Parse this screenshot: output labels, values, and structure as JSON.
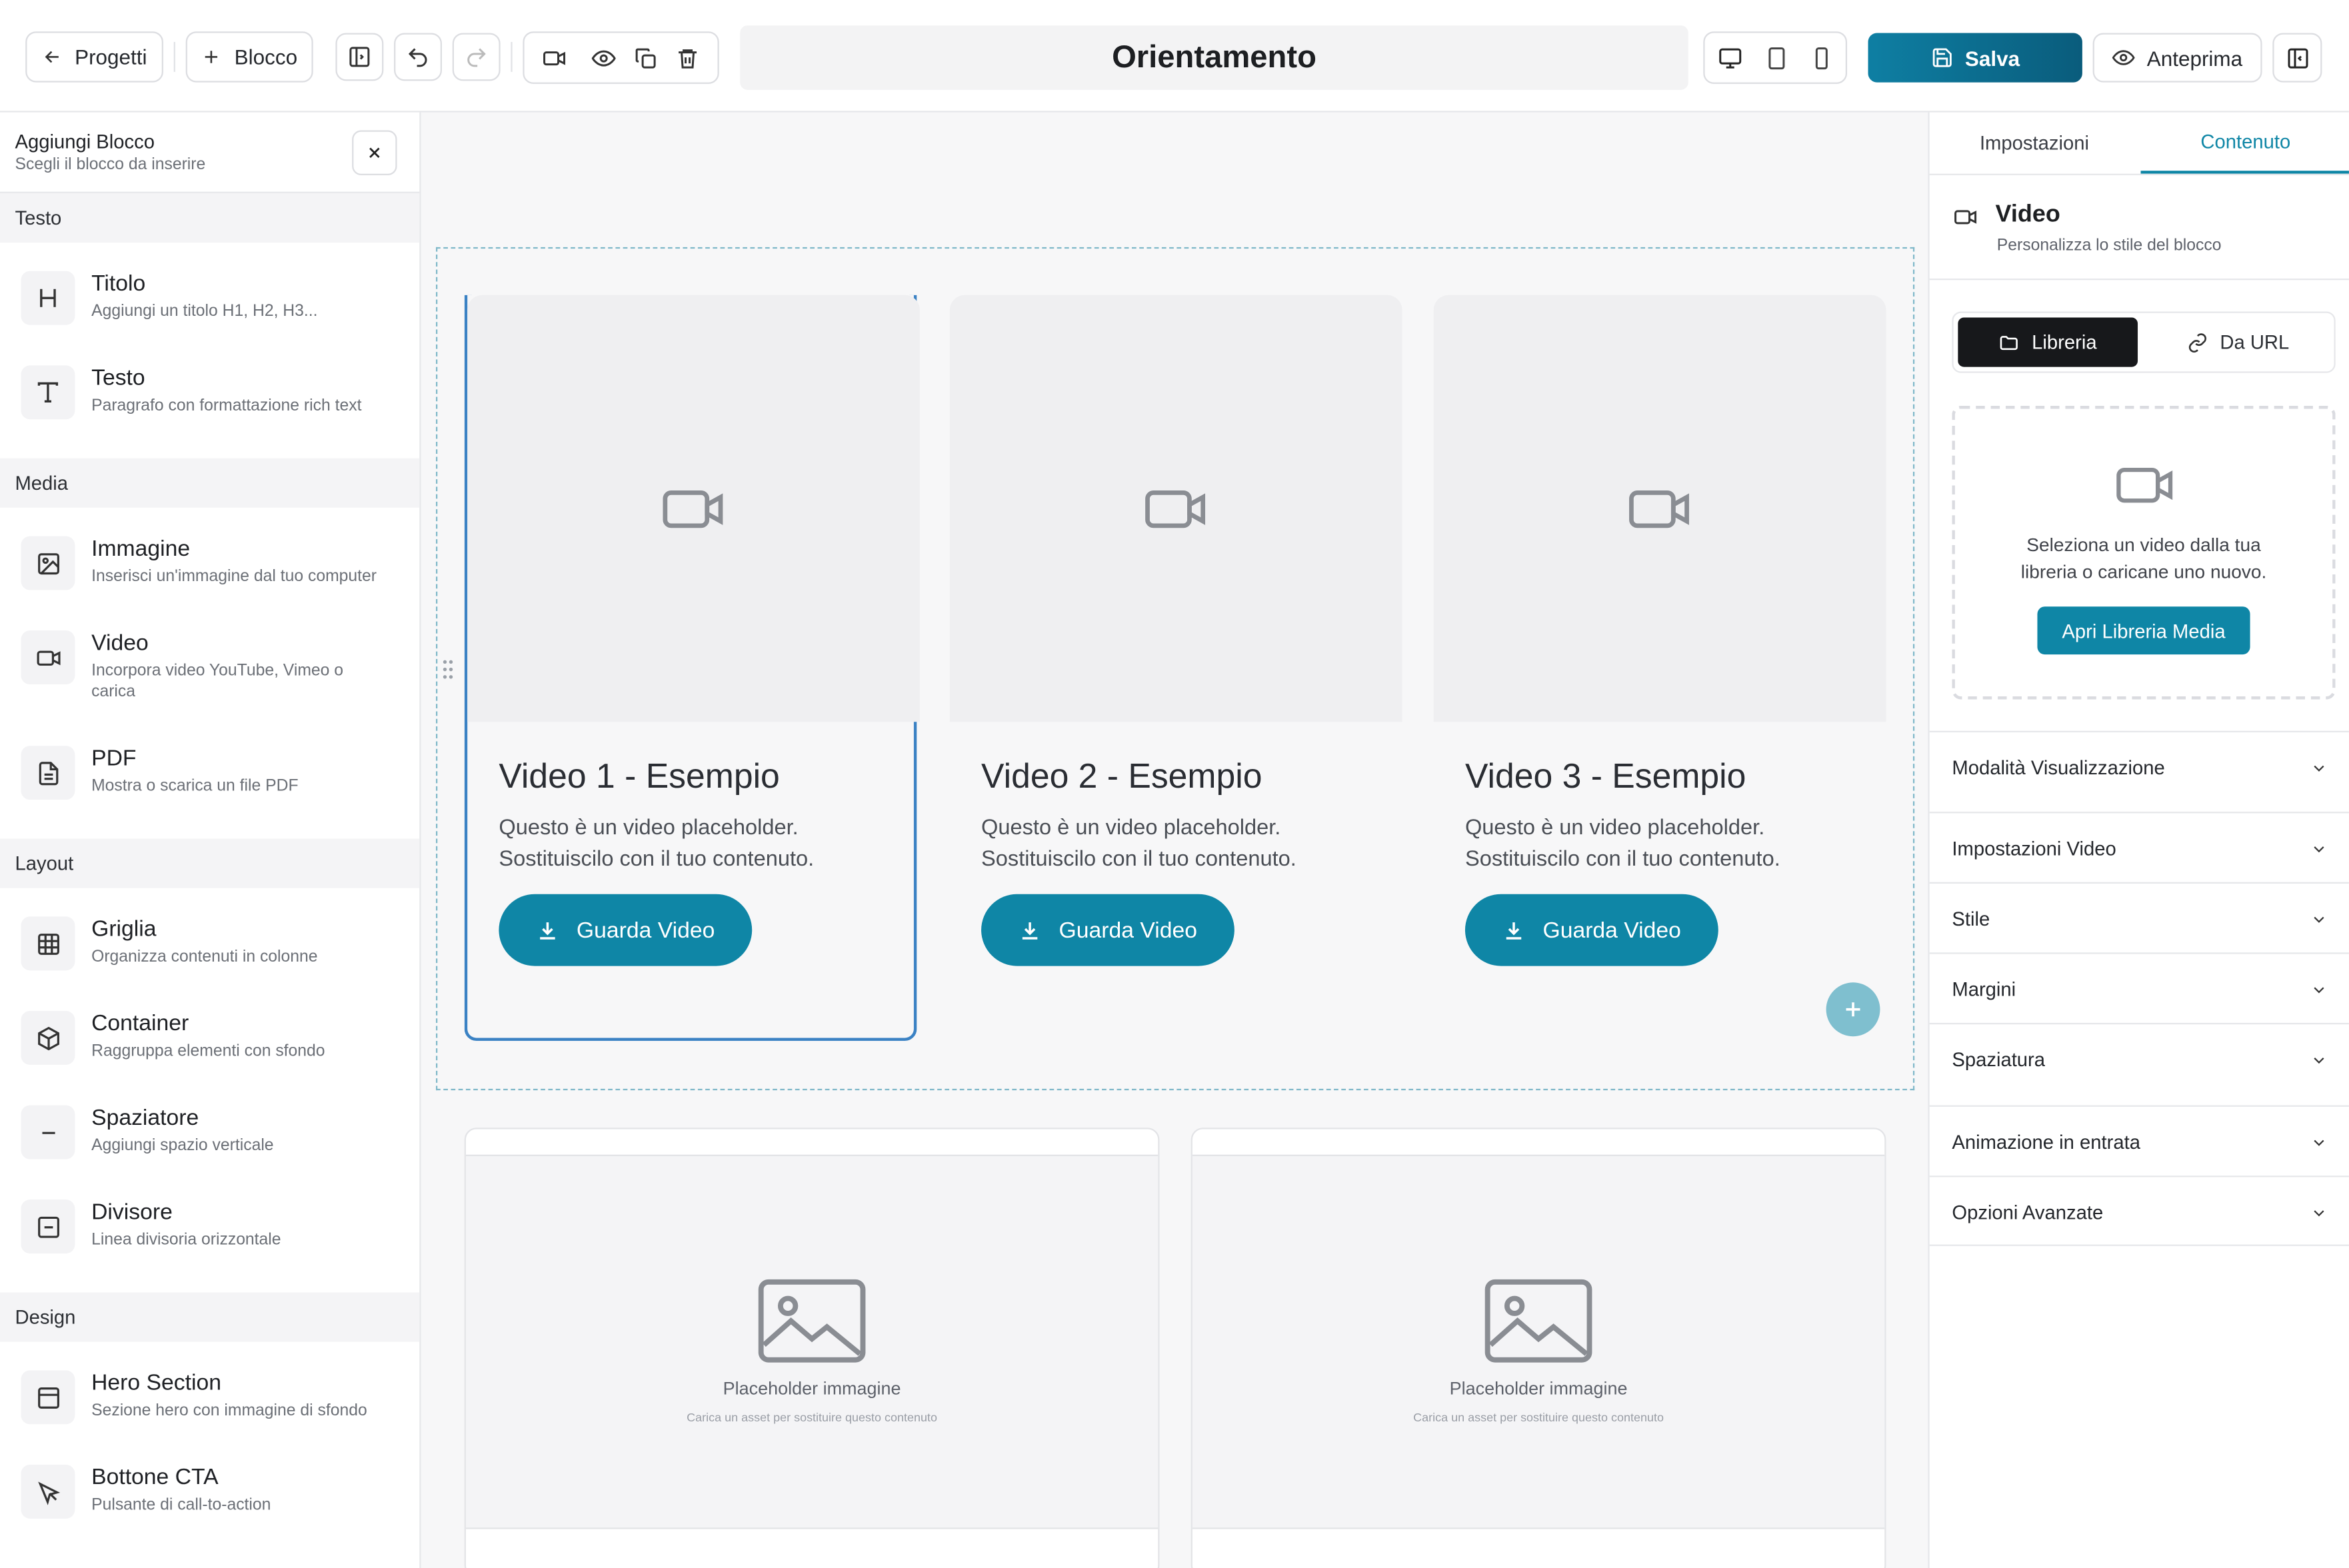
{
  "toolbar": {
    "back_label": "Progetti",
    "add_block_label": "Blocco",
    "page_title": "Orientamento",
    "save_label": "Salva",
    "preview_label": "Anteprima"
  },
  "left_panel": {
    "title": "Aggiungi Blocco",
    "subtitle": "Scegli il blocco da inserire",
    "sections": [
      {
        "label": "Testo",
        "items": [
          {
            "name": "Titolo",
            "desc": "Aggiungi un titolo H1, H2, H3...",
            "icon": "heading-icon"
          },
          {
            "name": "Testo",
            "desc": "Paragrafo con formattazione rich text",
            "icon": "text-icon"
          }
        ]
      },
      {
        "label": "Media",
        "items": [
          {
            "name": "Immagine",
            "desc": "Inserisci un'immagine dal tuo computer",
            "icon": "image-icon"
          },
          {
            "name": "Video",
            "desc": "Incorpora video YouTube, Vimeo o carica",
            "icon": "video-icon"
          },
          {
            "name": "PDF",
            "desc": "Mostra o scarica un file PDF",
            "icon": "file-icon"
          }
        ]
      },
      {
        "label": "Layout",
        "items": [
          {
            "name": "Griglia",
            "desc": "Organizza contenuti in colonne",
            "icon": "grid-icon"
          },
          {
            "name": "Container",
            "desc": "Raggruppa elementi con sfondo",
            "icon": "box-icon"
          },
          {
            "name": "Spaziatore",
            "desc": "Aggiungi spazio verticale",
            "icon": "minus-icon"
          },
          {
            "name": "Divisore",
            "desc": "Linea divisoria orizzontale",
            "icon": "divider-icon"
          }
        ]
      },
      {
        "label": "Design",
        "items": [
          {
            "name": "Hero Section",
            "desc": "Sezione hero con immagine di sfondo",
            "icon": "layout-icon"
          },
          {
            "name": "Bottone CTA",
            "desc": "Pulsante di call-to-action",
            "icon": "pointer-icon"
          }
        ]
      }
    ]
  },
  "canvas": {
    "video_cards": [
      {
        "title": "Video 1 - Esempio",
        "description": "Questo è un video placeholder. Sostituiscilo con il tuo contenuto.",
        "button": "Guarda Video"
      },
      {
        "title": "Video 2 - Esempio",
        "description": "Questo è un video placeholder. Sostituiscilo con il tuo contenuto.",
        "button": "Guarda Video"
      },
      {
        "title": "Video 3 - Esempio",
        "description": "Questo è un video placeholder. Sostituiscilo con il tuo contenuto.",
        "button": "Guarda Video"
      }
    ],
    "image_placeholders": [
      {
        "label": "Placeholder immagine",
        "hint": "Carica un asset per sostituire questo contenuto"
      },
      {
        "label": "Placeholder immagine",
        "hint": "Carica un asset per sostituire questo contenuto"
      }
    ]
  },
  "right_panel": {
    "tabs": [
      "Impostazioni",
      "Contenuto"
    ],
    "active_tab": "Contenuto",
    "block_title": "Video",
    "block_subtitle": "Personalizza lo stile del blocco",
    "source_tabs": [
      "Libreria",
      "Da URL"
    ],
    "drop_text_line1": "Seleziona un video dalla tua",
    "drop_text_line2": "libreria o caricane uno nuovo.",
    "open_library_label": "Apri Libreria Media",
    "accordions": [
      "Modalità Visualizzazione",
      "Impostazioni Video",
      "Stile",
      "Margini",
      "Spaziatura",
      "Animazione in entrata",
      "Opzioni Avanzate"
    ]
  },
  "colors": {
    "accent": "#0f86a6",
    "save_gradient_end": "#0a5c7c",
    "selection_border": "#3b82c4"
  }
}
